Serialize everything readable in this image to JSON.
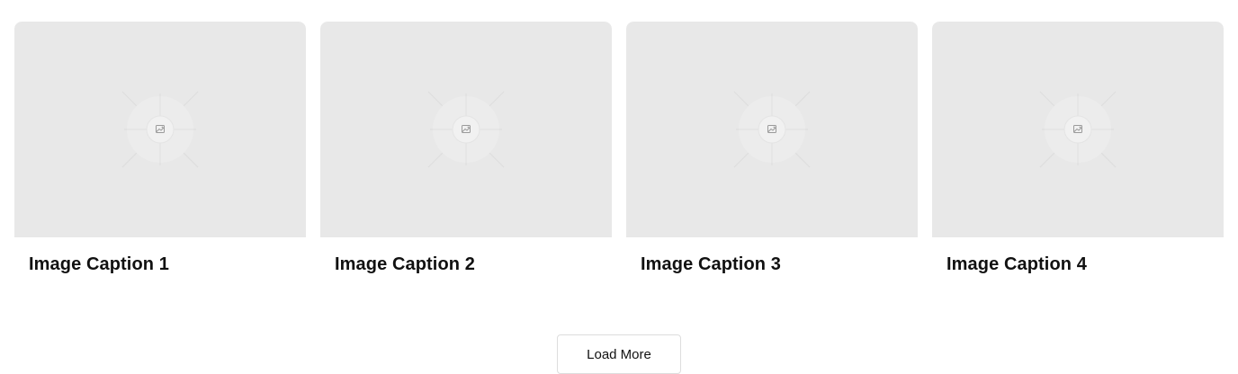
{
  "gallery": {
    "items": [
      {
        "caption": "Image Caption 1",
        "image_icon": "image-icon"
      },
      {
        "caption": "Image Caption 2",
        "image_icon": "image-icon"
      },
      {
        "caption": "Image Caption 3",
        "image_icon": "image-icon"
      },
      {
        "caption": "Image Caption 4",
        "image_icon": "image-icon"
      }
    ]
  },
  "load_more": {
    "label": "Load More"
  },
  "colors": {
    "placeholder_bg": "#e8e8e8",
    "text": "#111111",
    "button_border": "#dddddd"
  }
}
